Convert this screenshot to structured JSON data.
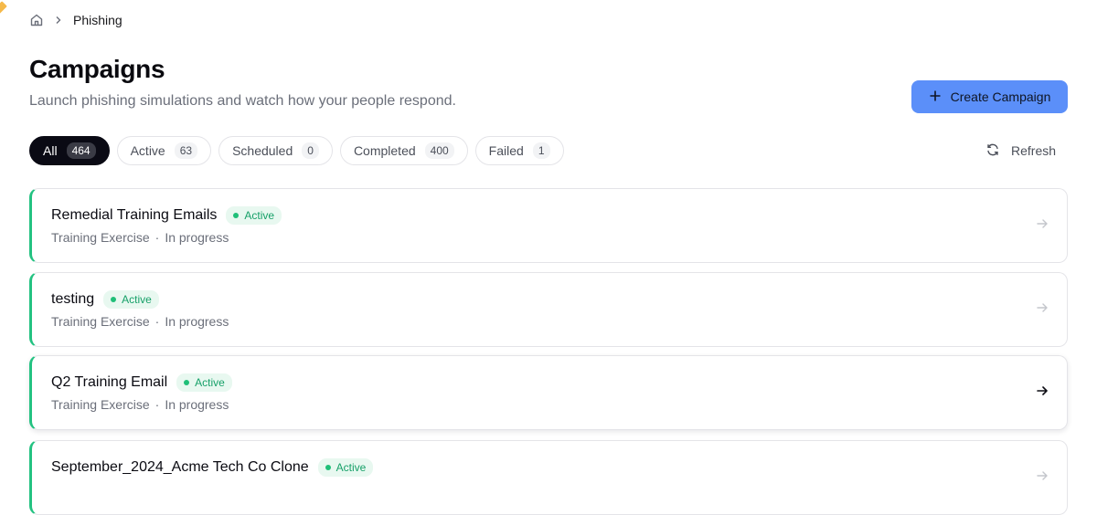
{
  "breadcrumb": {
    "current": "Phishing"
  },
  "header": {
    "title": "Campaigns",
    "subtitle": "Launch phishing simulations and watch how your people respond.",
    "create_label": "Create Campaign"
  },
  "filters": [
    {
      "label": "All",
      "count": "464",
      "selected": true
    },
    {
      "label": "Active",
      "count": "63"
    },
    {
      "label": "Scheduled",
      "count": "0"
    },
    {
      "label": "Completed",
      "count": "400"
    },
    {
      "label": "Failed",
      "count": "1"
    }
  ],
  "refresh_label": "Refresh",
  "campaigns": [
    {
      "name": "Remedial Training Emails",
      "status": "Active",
      "type": "Training Exercise",
      "progress": "In progress"
    },
    {
      "name": "testing",
      "status": "Active",
      "type": "Training Exercise",
      "progress": "In progress"
    },
    {
      "name": "Q2 Training Email",
      "status": "Active",
      "type": "Training Exercise",
      "progress": "In progress"
    },
    {
      "name": "September_2024_Acme Tech Co Clone",
      "status": "Active",
      "type": "",
      "progress": ""
    }
  ],
  "colors": {
    "accent": "#5b8ff9",
    "active_status": "#23c281",
    "selected_tab": "#0a0a14"
  },
  "icons": {
    "home": "home-icon",
    "chevron": "chevron-right-icon",
    "plus": "plus-icon",
    "refresh": "refresh-icon",
    "arrow": "arrow-right-icon"
  }
}
